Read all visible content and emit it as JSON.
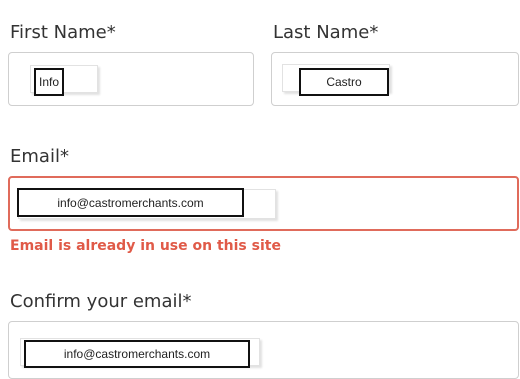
{
  "form": {
    "first_name": {
      "label": "First Name*",
      "value": "Info"
    },
    "last_name": {
      "label": "Last Name*",
      "value": "Castro"
    },
    "email": {
      "label": "Email*",
      "value": "info@castromerchants.com",
      "error": "Email is already in use on this site"
    },
    "confirm_email": {
      "label": "Confirm your email*",
      "value": "info@castromerchants.com"
    }
  },
  "colors": {
    "error": "#e05a48",
    "error_border": "#e06b5b",
    "border": "#cfcfcf"
  }
}
